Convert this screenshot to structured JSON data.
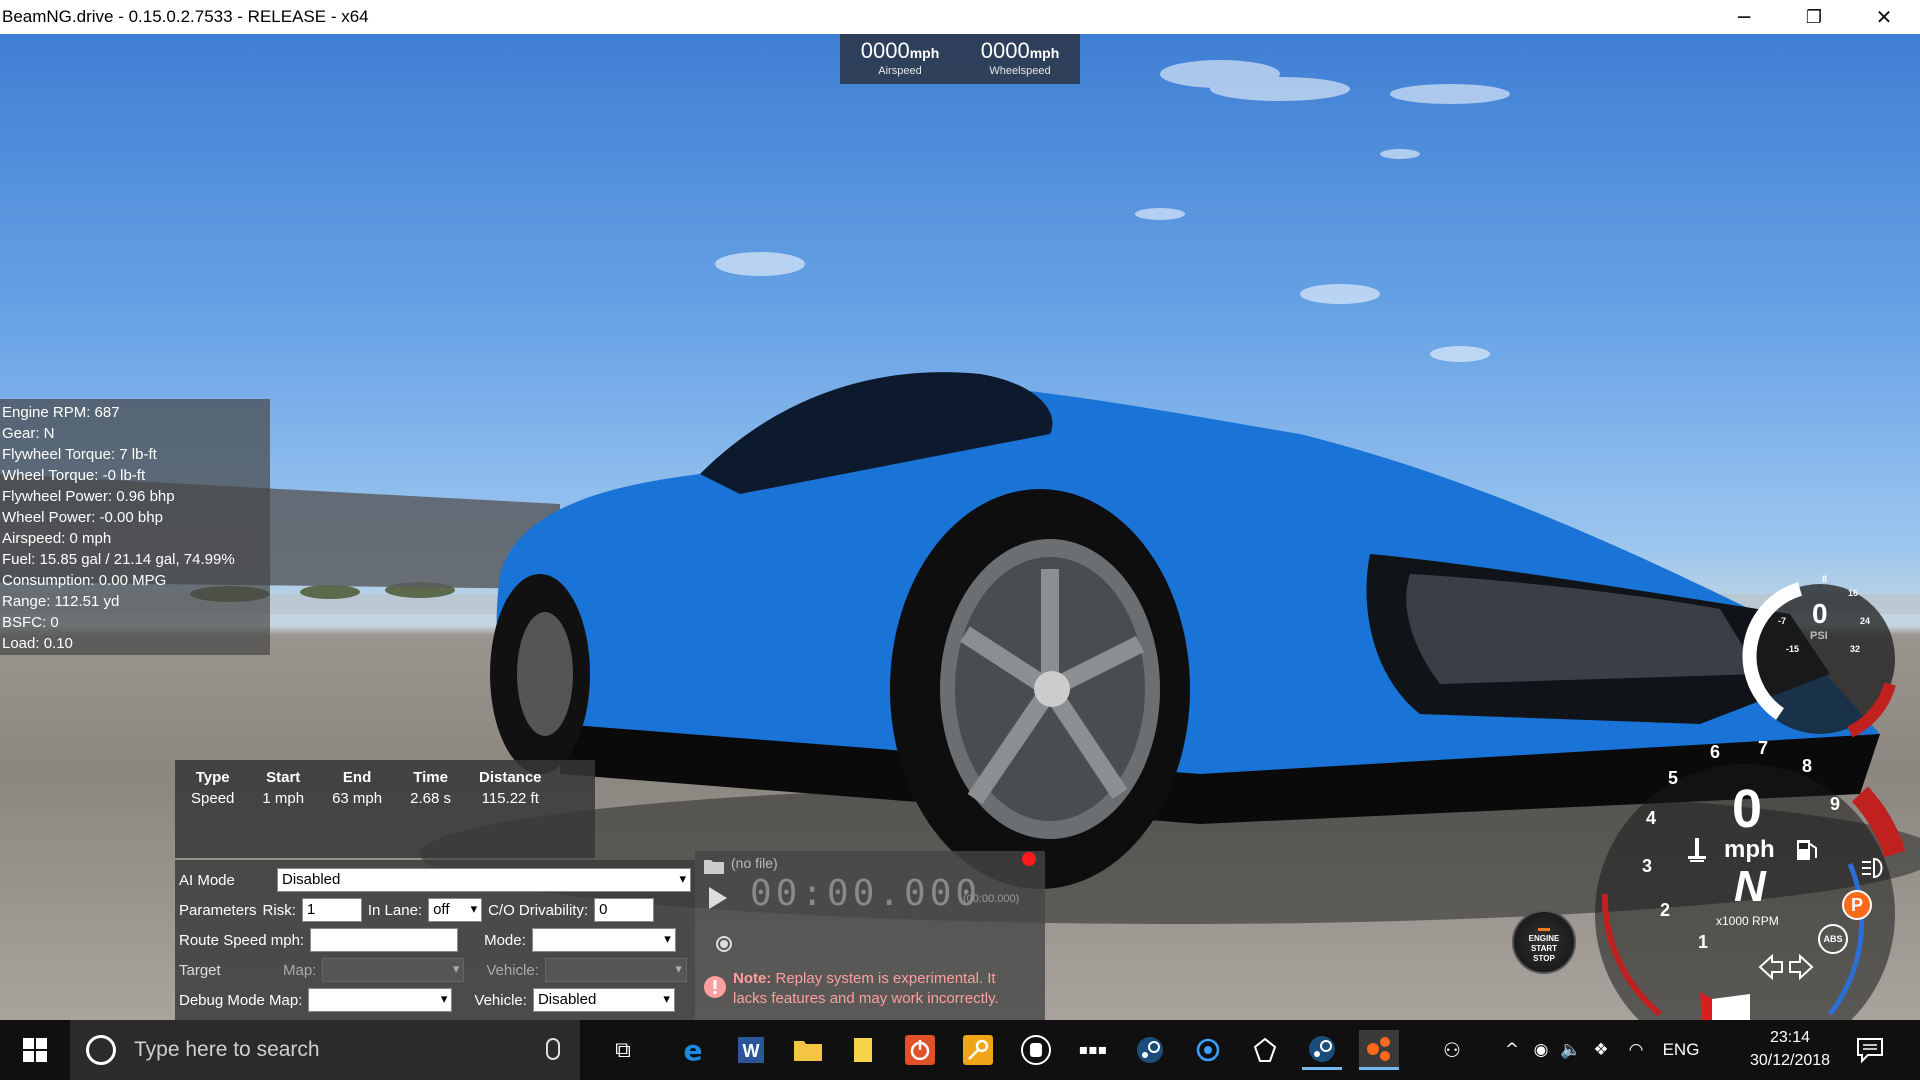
{
  "window": {
    "title": "BeamNG.drive - 0.15.0.2.7533 - RELEASE - x64",
    "minimize": "─",
    "restore": "❐",
    "close": "✕"
  },
  "speedometer_overlay": {
    "airspeed_value": "0000",
    "airspeed_unit": "mph",
    "airspeed_label": "Airspeed",
    "wheelspeed_value": "0000",
    "wheelspeed_unit": "mph",
    "wheelspeed_label": "Wheelspeed"
  },
  "debug_stats": [
    "Engine RPM: 687",
    "Gear: N",
    "Flywheel Torque: 7 lb-ft",
    "Wheel Torque: -0 lb-ft",
    "Flywheel Power: 0.96 bhp",
    "Wheel Power: -0.00 bhp",
    "Airspeed: 0 mph",
    "Fuel: 15.85 gal / 21.14 gal, 74.99%",
    "Consumption: 0.00 MPG",
    "Range: 112.51 yd",
    "BSFC: 0",
    "Load: 0.10"
  ],
  "drag_table": {
    "headers": [
      "Type",
      "Start",
      "End",
      "Time",
      "Distance"
    ],
    "row": [
      "Speed",
      "1 mph",
      "63 mph",
      "2.68 s",
      "115.22 ft"
    ]
  },
  "ai_panel": {
    "ai_mode_label": "AI Mode",
    "ai_mode_value": "Disabled",
    "parameters_label": "Parameters",
    "risk_label": "Risk:",
    "risk_value": "1",
    "in_lane_label": "In Lane:",
    "in_lane_value": "off",
    "drivability_label": "C/O Drivability:",
    "drivability_value": "0",
    "route_speed_label": "Route Speed mph:",
    "route_speed_value": "",
    "mode_label": "Mode:",
    "mode_value": "",
    "target_label": "Target",
    "target_map_label": "Map:",
    "target_map_value": "",
    "target_vehicle_label": "Vehicle:",
    "target_vehicle_value": "",
    "debug_mode_label": "Debug Mode Map:",
    "debug_map_value": "",
    "debug_vehicle_label": "Vehicle:",
    "debug_vehicle_value": "Disabled"
  },
  "replay": {
    "file": "(no file)",
    "time": "00:00.000",
    "time_small": "(00:00.000)",
    "note_bold": "Note:",
    "note_text": " Replay system is experimental. It lacks features and may work incorrectly."
  },
  "dashboard": {
    "boost_value": "0",
    "boost_unit": "PSI",
    "boost_ticks": [
      "8",
      "16",
      "24",
      "32",
      "-7",
      "-15"
    ],
    "speed_value": "0",
    "speed_unit": "mph",
    "gear_value": "N",
    "rpm_label": "x1000 RPM",
    "rpm_ticks": [
      "1",
      "2",
      "3",
      "4",
      "5",
      "6",
      "7",
      "8",
      "9"
    ],
    "park_label": "P",
    "abs_label": "ABS",
    "engine_button_lines": [
      "ENGINE",
      "START",
      "STOP"
    ]
  },
  "taskbar": {
    "search_placeholder": "Type here to search",
    "language": "ENG",
    "time": "23:14",
    "date": "30/12/2018"
  },
  "colors": {
    "car_body": "#1a73d6",
    "taskbar": "#101010",
    "rpm_redline": "#c0201e",
    "note_text": "#ff9f9f"
  }
}
